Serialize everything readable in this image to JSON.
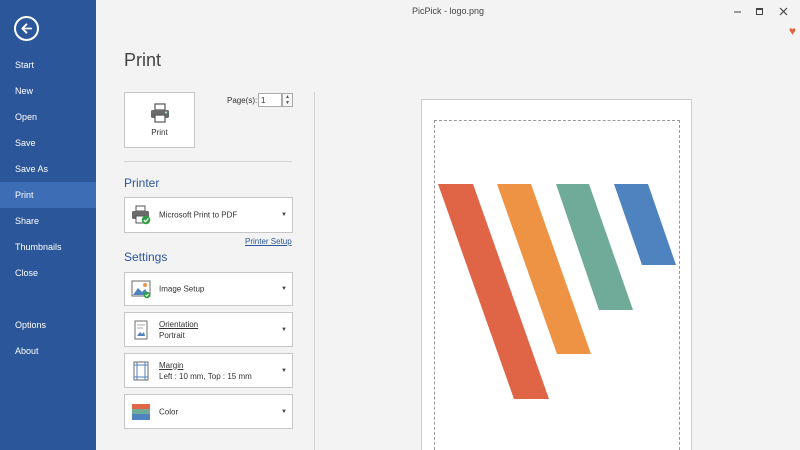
{
  "window": {
    "title": "PicPick - logo.png"
  },
  "sidebar": {
    "items": [
      {
        "label": "Start"
      },
      {
        "label": "New"
      },
      {
        "label": "Open"
      },
      {
        "label": "Save"
      },
      {
        "label": "Save As"
      },
      {
        "label": "Print",
        "active": true
      },
      {
        "label": "Share"
      },
      {
        "label": "Thumbnails"
      },
      {
        "label": "Close"
      },
      {
        "label": "Options"
      },
      {
        "label": "About"
      }
    ]
  },
  "print": {
    "heading": "Print",
    "print_button_label": "Print",
    "pages_label": "Page(s):",
    "pages_value": "1"
  },
  "printer": {
    "heading": "Printer",
    "selected": "Microsoft Print to PDF",
    "setup_link": "Printer Setup"
  },
  "settings": {
    "heading": "Settings",
    "image_setup": "Image Setup",
    "orientation_label": "Orientation",
    "orientation_value": "Portrait",
    "margin_label": "Margin",
    "margin_value": "Left : 10 mm, Top : 15 mm",
    "color": "Color"
  },
  "colors": {
    "sidebar": "#2b579a",
    "sidebar_active": "#3c6db5",
    "accent": "#2b579a",
    "logo_red": "#e06446",
    "logo_orange": "#ee9344",
    "logo_green": "#70ab99",
    "logo_blue": "#4e83bf"
  }
}
